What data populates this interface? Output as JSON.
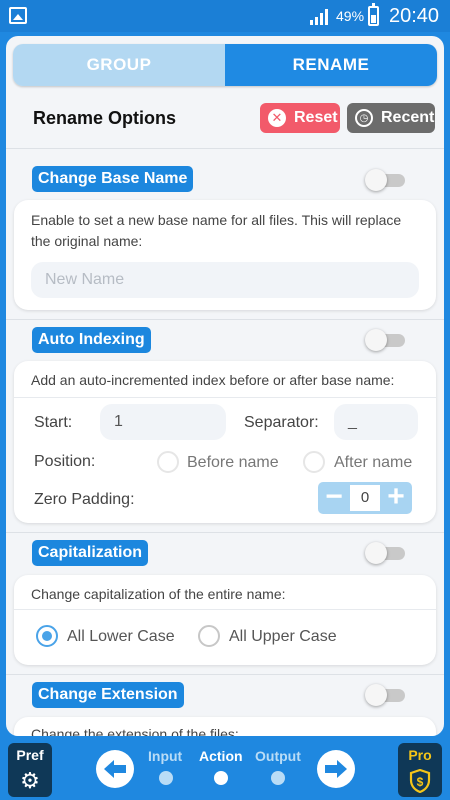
{
  "status_bar": {
    "battery": "49%",
    "time": "20:40"
  },
  "tabs": [
    {
      "label": "GROUP",
      "selected": false
    },
    {
      "label": "RENAME",
      "selected": true
    }
  ],
  "header": {
    "title": "Rename Options",
    "reset_label": "Reset",
    "recent_label": "Recent"
  },
  "sections": {
    "base_name": {
      "title": "Change Base Name",
      "enabled": false,
      "description": "Enable to set a new base name for all files. This will replace the original name:",
      "input_placeholder": "New Name",
      "input_value": ""
    },
    "auto_indexing": {
      "title": "Auto Indexing",
      "enabled": false,
      "description": "Add an auto-incremented index before or after base name:",
      "start_label": "Start:",
      "start_value": "1",
      "separator_label": "Separator:",
      "separator_value": "_",
      "position_label": "Position:",
      "position_options": [
        "Before name",
        "After name"
      ],
      "position_selected": "Before name",
      "zero_padding_label": "Zero Padding:",
      "zero_padding_value": "0"
    },
    "capitalization": {
      "title": "Capitalization",
      "enabled": false,
      "description": "Change capitalization of the entire name:",
      "options": [
        "All Lower Case",
        "All Upper Case"
      ],
      "selected": "All Lower Case"
    },
    "extension": {
      "title": "Change Extension",
      "enabled": false,
      "description": "Change the extension of the files:"
    }
  },
  "bottom_bar": {
    "pref_label": "Pref",
    "pro_label": "Pro",
    "steps": [
      {
        "label": "Input",
        "active": false
      },
      {
        "label": "Action",
        "active": true
      },
      {
        "label": "Output",
        "active": false
      }
    ]
  },
  "colors": {
    "accent": "#1f88e0",
    "section_title_bg": "#1c87de",
    "reset": "#f25a6a",
    "recent": "#6c6c6c",
    "bottom_button": "#0f3857"
  }
}
